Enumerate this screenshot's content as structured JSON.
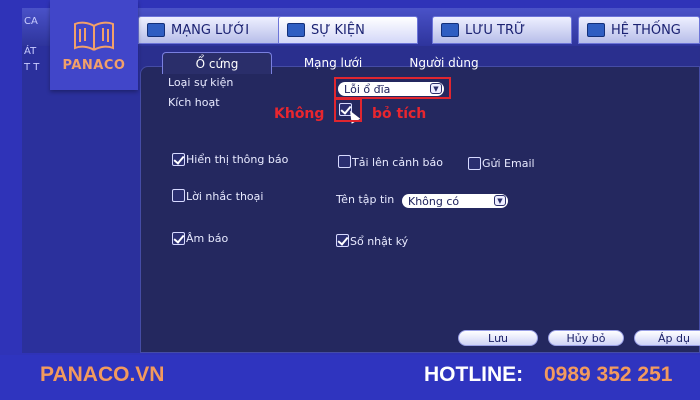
{
  "top_tabs": [
    {
      "label": "MẠNG LƯỚI",
      "icon": "network-icon"
    },
    {
      "label": "SỰ KIỆN",
      "icon": "event-icon"
    },
    {
      "label": "LƯU TRỮ",
      "icon": "storage-icon"
    },
    {
      "label": "HỆ THỐNG",
      "icon": "system-icon"
    }
  ],
  "left_stub": [
    "CA",
    "ÁT",
    "T T"
  ],
  "logo": {
    "text": "PANACO",
    "icon": "open-book-icon"
  },
  "sub_tabs": [
    "Ổ cứng",
    "Mạng lưới",
    "Người dùng"
  ],
  "form": {
    "event_type_label": "Loại sự kiện",
    "event_type_value": "Lỗi ổ đĩa",
    "enable_label": "Kích hoạt",
    "show_message_label": "Hiển thị thông báo",
    "upload_alarm_label": "Tải lên cảnh báo",
    "send_email_label": "Gửi Email",
    "voice_prompt_label": "Lời nhắc thoại",
    "file_name_label": "Tên tập tin",
    "file_name_value": "Không có",
    "buzzer_label": "Âm báo",
    "log_label": "Sổ nhật ký"
  },
  "annotation": {
    "left": "Không",
    "right": "bỏ tích"
  },
  "buttons": {
    "save": "Lưu",
    "cancel": "Hủy bỏ",
    "apply": "Áp dụ"
  },
  "footer": {
    "site": "PANACO.VN",
    "hotline_label": "HOTLINE:",
    "phone": "0989 352 251"
  },
  "colors": {
    "brand_orange": "#f29a5e",
    "annotation_red": "#e8262f",
    "panel_bg": "#24285f"
  }
}
